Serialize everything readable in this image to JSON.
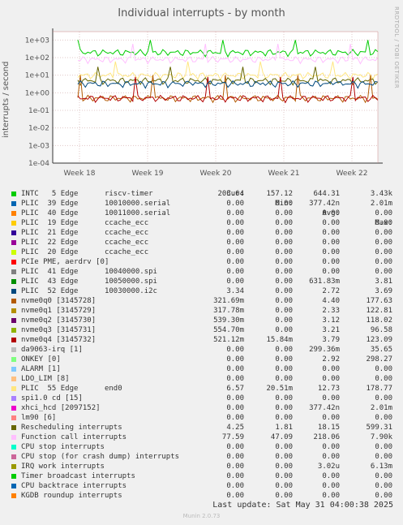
{
  "chart_data": {
    "type": "line",
    "title": "Individual interrupts - by month",
    "side_note": "RRDTOOL / TOBI OETIKER",
    "ylabel": "interrupts / second",
    "yscale": "log",
    "ylim": [
      0.0001,
      3000
    ],
    "y_ticks": [
      "1e+03",
      "1e+02",
      "1e+01",
      "1e+00",
      "1e-01",
      "1e-02",
      "1e-03",
      "1e-04"
    ],
    "x_ticks": [
      "Week 18",
      "Week 19",
      "Week 20",
      "Week 21",
      "Week 22"
    ],
    "grid": true,
    "columns": [
      "Cur:",
      "Min:",
      "Avg:",
      "Max:"
    ],
    "series": [
      {
        "name": "INTC   5 Edge      riscv-timer",
        "color": "#00cc00",
        "cur": "203.64",
        "min": "157.12",
        "avg": "644.31",
        "max": "3.43k"
      },
      {
        "name": "PLIC  39 Edge      10010000.serial",
        "color": "#0066b3",
        "cur": "0.00",
        "min": "0.00",
        "avg": "377.42n",
        "max": "2.01m"
      },
      {
        "name": "PLIC  40 Edge      10011000.serial",
        "color": "#ff8000",
        "cur": "0.00",
        "min": "0.00",
        "avg": "0.00",
        "max": "0.00"
      },
      {
        "name": "PLIC  19 Edge      ccache_ecc",
        "color": "#ffcc00",
        "cur": "0.00",
        "min": "0.00",
        "avg": "0.00",
        "max": "0.00"
      },
      {
        "name": "PLIC  21 Edge      ccache_ecc",
        "color": "#330099",
        "cur": "0.00",
        "min": "0.00",
        "avg": "0.00",
        "max": "0.00"
      },
      {
        "name": "PLIC  22 Edge      ccache_ecc",
        "color": "#990099",
        "cur": "0.00",
        "min": "0.00",
        "avg": "0.00",
        "max": "0.00"
      },
      {
        "name": "PLIC  20 Edge      ccache_ecc",
        "color": "#ccff00",
        "cur": "0.00",
        "min": "0.00",
        "avg": "0.00",
        "max": "0.00"
      },
      {
        "name": "PCIe PME, aerdrv [0]",
        "color": "#ff0000",
        "cur": "0.00",
        "min": "0.00",
        "avg": "0.00",
        "max": "0.00"
      },
      {
        "name": "PLIC  41 Edge      10040000.spi",
        "color": "#808080",
        "cur": "0.00",
        "min": "0.00",
        "avg": "0.00",
        "max": "0.00"
      },
      {
        "name": "PLIC  43 Edge      10050000.spi",
        "color": "#008f00",
        "cur": "0.00",
        "min": "0.00",
        "avg": "631.83m",
        "max": "3.81"
      },
      {
        "name": "PLIC  52 Edge      10030000.i2c",
        "color": "#00487d",
        "cur": "3.34",
        "min": "0.00",
        "avg": "2.72",
        "max": "3.69"
      },
      {
        "name": "nvme0q0 [3145728]",
        "color": "#b35a00",
        "cur": "321.69m",
        "min": "0.00",
        "avg": "4.40",
        "max": "177.63"
      },
      {
        "name": "nvme0q1 [3145729]",
        "color": "#b38f00",
        "cur": "317.78m",
        "min": "0.00",
        "avg": "2.33",
        "max": "122.81"
      },
      {
        "name": "nvme0q2 [3145730]",
        "color": "#6b006b",
        "cur": "539.30m",
        "min": "0.00",
        "avg": "3.12",
        "max": "118.02"
      },
      {
        "name": "nvme0q3 [3145731]",
        "color": "#8fb300",
        "cur": "554.70m",
        "min": "0.00",
        "avg": "3.21",
        "max": "96.58"
      },
      {
        "name": "nvme0q4 [3145732]",
        "color": "#b30000",
        "cur": "521.12m",
        "min": "15.84m",
        "avg": "3.79",
        "max": "123.09"
      },
      {
        "name": "da9063-irq [1]",
        "color": "#bebebe",
        "cur": "0.00",
        "min": "0.00",
        "avg": "299.36m",
        "max": "35.65"
      },
      {
        "name": "ONKEY [0]",
        "color": "#80ff80",
        "cur": "0.00",
        "min": "0.00",
        "avg": "2.92",
        "max": "298.27"
      },
      {
        "name": "ALARM [1]",
        "color": "#80c9ff",
        "cur": "0.00",
        "min": "0.00",
        "avg": "0.00",
        "max": "0.00"
      },
      {
        "name": "LDO_LIM [8]",
        "color": "#ffc080",
        "cur": "0.00",
        "min": "0.00",
        "avg": "0.00",
        "max": "0.00"
      },
      {
        "name": "PLIC  55 Edge      end0",
        "color": "#ffe680",
        "cur": "6.57",
        "min": "20.51m",
        "avg": "12.73",
        "max": "178.77"
      },
      {
        "name": "spi1.0 cd [15]",
        "color": "#aa80ff",
        "cur": "0.00",
        "min": "0.00",
        "avg": "0.00",
        "max": "0.00"
      },
      {
        "name": "xhci_hcd [2097152]",
        "color": "#ee00cc",
        "cur": "0.00",
        "min": "0.00",
        "avg": "377.42n",
        "max": "2.01m"
      },
      {
        "name": "lm90 [6]",
        "color": "#ff8080",
        "cur": "0.00",
        "min": "0.00",
        "avg": "0.00",
        "max": "0.00"
      },
      {
        "name": "Rescheduling interrupts",
        "color": "#666600",
        "cur": "4.25",
        "min": "1.81",
        "avg": "18.15",
        "max": "599.31"
      },
      {
        "name": "Function call interrupts",
        "color": "#ffbfff",
        "cur": "77.59",
        "min": "47.09",
        "avg": "218.06",
        "max": "7.90k"
      },
      {
        "name": "CPU stop interrupts",
        "color": "#00ffcc",
        "cur": "0.00",
        "min": "0.00",
        "avg": "0.00",
        "max": "0.00"
      },
      {
        "name": "CPU stop (for crash dump) interrupts",
        "color": "#cc6699",
        "cur": "0.00",
        "min": "0.00",
        "avg": "0.00",
        "max": "0.00"
      },
      {
        "name": "IRQ work interrupts",
        "color": "#999900",
        "cur": "0.00",
        "min": "0.00",
        "avg": "3.02u",
        "max": "6.13m"
      },
      {
        "name": "Timer broadcast interrupts",
        "color": "#00cc00",
        "cur": "0.00",
        "min": "0.00",
        "avg": "0.00",
        "max": "0.00"
      },
      {
        "name": "CPU backtrace interrupts",
        "color": "#0066b3",
        "cur": "0.00",
        "min": "0.00",
        "avg": "0.00",
        "max": "0.00"
      },
      {
        "name": "KGDB roundup interrupts",
        "color": "#ff8000",
        "cur": "0.00",
        "min": "0.00",
        "avg": "0.00",
        "max": "0.00"
      }
    ],
    "plotted_levels": [
      {
        "series": "INTC   5 Edge      riscv-timer",
        "level": 200,
        "spike": 1000
      },
      {
        "series": "Function call interrupts",
        "level": 80,
        "spike": 600
      },
      {
        "series": "PLIC  55 Edge      end0",
        "level": 10,
        "spike": 60
      },
      {
        "series": "Rescheduling interrupts",
        "level": 5,
        "spike": 30
      },
      {
        "series": "nvme0q0 [3145728]",
        "level": 0.5,
        "spike": 10
      },
      {
        "series": "nvme0q4 [3145732]",
        "level": 0.5,
        "spike": 8
      },
      {
        "series": "PLIC  52 Edge      10030000.i2c",
        "level": 3.34,
        "spike": 3.69
      }
    ]
  },
  "footer": {
    "last_update": "Last update: Sat May 31 04:00:38 2025",
    "brand": "Munin 2.0.73"
  }
}
